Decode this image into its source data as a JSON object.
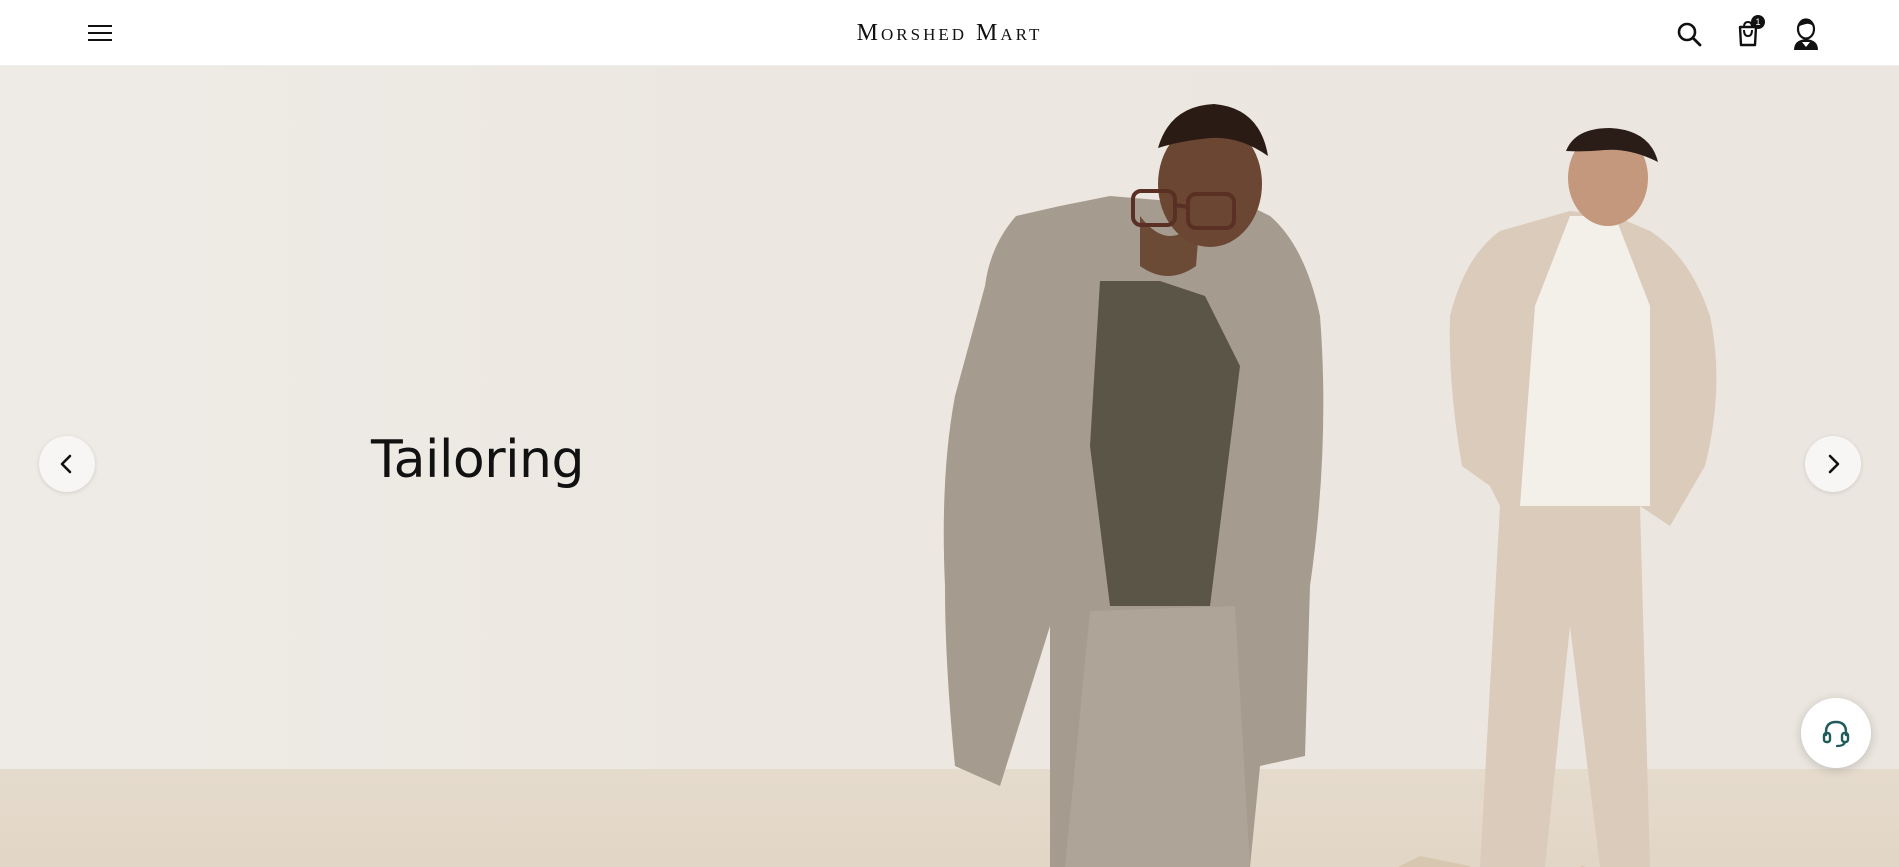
{
  "header": {
    "brand": "Morshed Mart",
    "cart_count": "1",
    "icons": {
      "menu": "hamburger-menu-icon",
      "search": "search-icon",
      "cart": "shopping-bag-icon",
      "account": "user-avatar-icon"
    }
  },
  "hero": {
    "title": "Tailoring",
    "prev_icon": "chevron-left-icon",
    "next_icon": "chevron-right-icon"
  },
  "support": {
    "icon": "headset-icon",
    "accent": "#1f5b5a"
  },
  "colors": {
    "background": "#eeebe6",
    "floor": "#e4d9ca",
    "text": "#111111"
  }
}
